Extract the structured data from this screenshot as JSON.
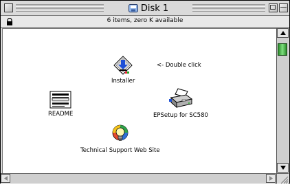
{
  "window": {
    "title": "Disk 1",
    "info": "6 items, zero K available"
  },
  "items": {
    "installer": "Installer",
    "hint": "<- Double click",
    "readme": "README",
    "epsetup": "EPSetup for SC580",
    "support": "Technical Support Web Site"
  },
  "icons": {
    "title": "disk-icon",
    "lock": "lock-icon",
    "installer": "installer-icon",
    "readme": "document-icon",
    "epsetup": "printer-icon",
    "support": "lightbulb-icon"
  },
  "colors": {
    "scroll_thumb": "#4fbf4f",
    "installer_arrow": "#1d4fd6"
  }
}
